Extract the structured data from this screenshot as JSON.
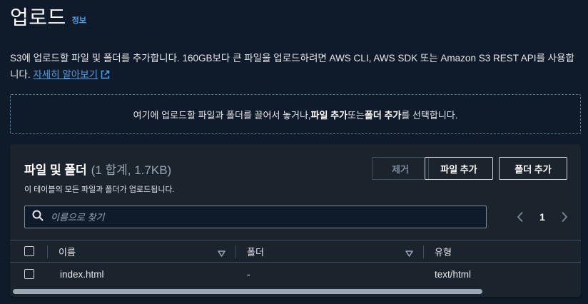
{
  "header": {
    "title": "업로드",
    "info_link": "정보"
  },
  "description": {
    "text": "S3에 업로드할 파일 및 폴더를 추가합니다. 160GB보다 큰 파일을 업로드하려면 AWS CLI, AWS SDK 또는 Amazon S3 REST API를 사용합니다.",
    "link": "자세히 알아보기"
  },
  "dropzone": {
    "prefix": "여기에 업로드할 파일과 폴더를 끌어서 놓거나, ",
    "add_files": "파일 추가",
    "or": " 또는 ",
    "add_folder": "폴더 추가",
    "suffix": "를 선택합니다."
  },
  "panel": {
    "title": "파일 및 폴더",
    "count": "(1 합계, 1.7KB)",
    "subtitle": "이 테이블의 모든 파일과 폴더가 업로드됩니다.",
    "buttons": {
      "remove": "제거",
      "add_files": "파일 추가",
      "add_folder": "폴더 추가"
    },
    "search_placeholder": "이름으로 찾기",
    "page": "1"
  },
  "table": {
    "columns": [
      "이름",
      "폴더",
      "유형"
    ],
    "rows": [
      {
        "name": "index.html",
        "folder": "-",
        "type": "text/html"
      }
    ]
  },
  "colors": {
    "background": "#0f1b2a",
    "panel": "#1b232d",
    "link": "#539fe5",
    "border": "#414d5c"
  },
  "icons": [
    "external-link-icon",
    "search-icon",
    "chevron-left-icon",
    "chevron-right-icon",
    "sort-down-icon"
  ]
}
